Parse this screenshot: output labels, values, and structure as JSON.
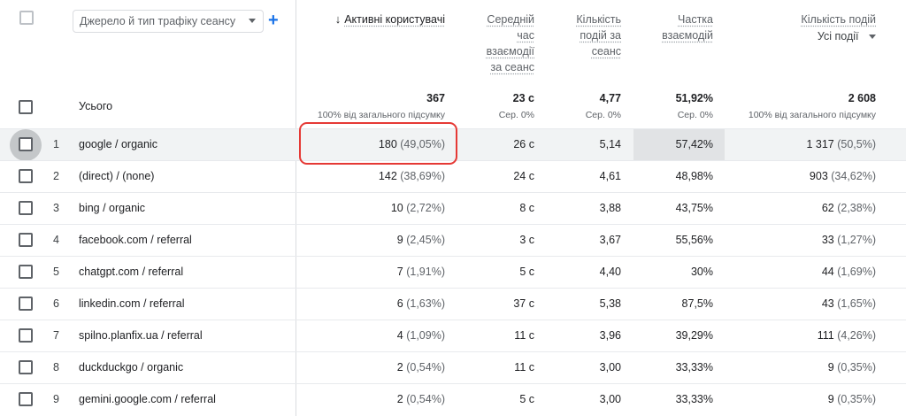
{
  "header": {
    "dimension_select": "Джерело й тип трафіку сеансу",
    "columns": {
      "users": "Активні користувачі",
      "avg_time": [
        "Середній",
        "час",
        "взаємодії",
        "за сеанс"
      ],
      "events_per_session": [
        "Кількість",
        "подій за",
        "сеанс"
      ],
      "engagement_rate": [
        "Частка",
        "взаємодій"
      ],
      "event_count": "Кількість подій",
      "event_filter": "Усі події"
    }
  },
  "totals": {
    "label": "Усього",
    "users": "367",
    "users_sub": "100% від загального підсумку",
    "avg_time": "23 с",
    "avg_time_sub": "Сер. 0%",
    "events_per_session": "4,77",
    "events_per_session_sub": "Сер. 0%",
    "engagement_rate": "51,92%",
    "engagement_rate_sub": "Сер. 0%",
    "event_count": "2 608",
    "event_count_sub": "100% від загального підсумку"
  },
  "rows": [
    {
      "num": "1",
      "dim": "google / organic",
      "users": "180",
      "users_pct": "(49,05%)",
      "avg_time": "26 с",
      "eps": "5,14",
      "eng": "57,42%",
      "events": "1 317",
      "events_pct": "(50,5%)"
    },
    {
      "num": "2",
      "dim": "(direct) / (none)",
      "users": "142",
      "users_pct": "(38,69%)",
      "avg_time": "24 с",
      "eps": "4,61",
      "eng": "48,98%",
      "events": "903",
      "events_pct": "(34,62%)"
    },
    {
      "num": "3",
      "dim": "bing / organic",
      "users": "10",
      "users_pct": "(2,72%)",
      "avg_time": "8 с",
      "eps": "3,88",
      "eng": "43,75%",
      "events": "62",
      "events_pct": "(2,38%)"
    },
    {
      "num": "4",
      "dim": "facebook.com / referral",
      "users": "9",
      "users_pct": "(2,45%)",
      "avg_time": "3 с",
      "eps": "3,67",
      "eng": "55,56%",
      "events": "33",
      "events_pct": "(1,27%)"
    },
    {
      "num": "5",
      "dim": "chatgpt.com / referral",
      "users": "7",
      "users_pct": "(1,91%)",
      "avg_time": "5 с",
      "eps": "4,40",
      "eng": "30%",
      "events": "44",
      "events_pct": "(1,69%)"
    },
    {
      "num": "6",
      "dim": "linkedin.com / referral",
      "users": "6",
      "users_pct": "(1,63%)",
      "avg_time": "37 с",
      "eps": "5,38",
      "eng": "87,5%",
      "events": "43",
      "events_pct": "(1,65%)"
    },
    {
      "num": "7",
      "dim": "spilno.planfix.ua / referral",
      "users": "4",
      "users_pct": "(1,09%)",
      "avg_time": "11 с",
      "eps": "3,96",
      "eng": "39,29%",
      "events": "111",
      "events_pct": "(4,26%)"
    },
    {
      "num": "8",
      "dim": "duckduckgo / organic",
      "users": "2",
      "users_pct": "(0,54%)",
      "avg_time": "11 с",
      "eps": "3,00",
      "eng": "33,33%",
      "events": "9",
      "events_pct": "(0,35%)"
    },
    {
      "num": "9",
      "dim": "gemini.google.com / referral",
      "users": "2",
      "users_pct": "(0,54%)",
      "avg_time": "5 с",
      "eps": "3,00",
      "eng": "33,33%",
      "events": "9",
      "events_pct": "(0,35%)"
    }
  ],
  "colors": {
    "accent": "#1a73e8",
    "highlight_border": "#e53935",
    "row_hover": "#f1f3f4"
  },
  "icons": {
    "add": "plus-icon",
    "sort": "arrow-down-icon",
    "dropdown": "chevron-down-icon"
  }
}
